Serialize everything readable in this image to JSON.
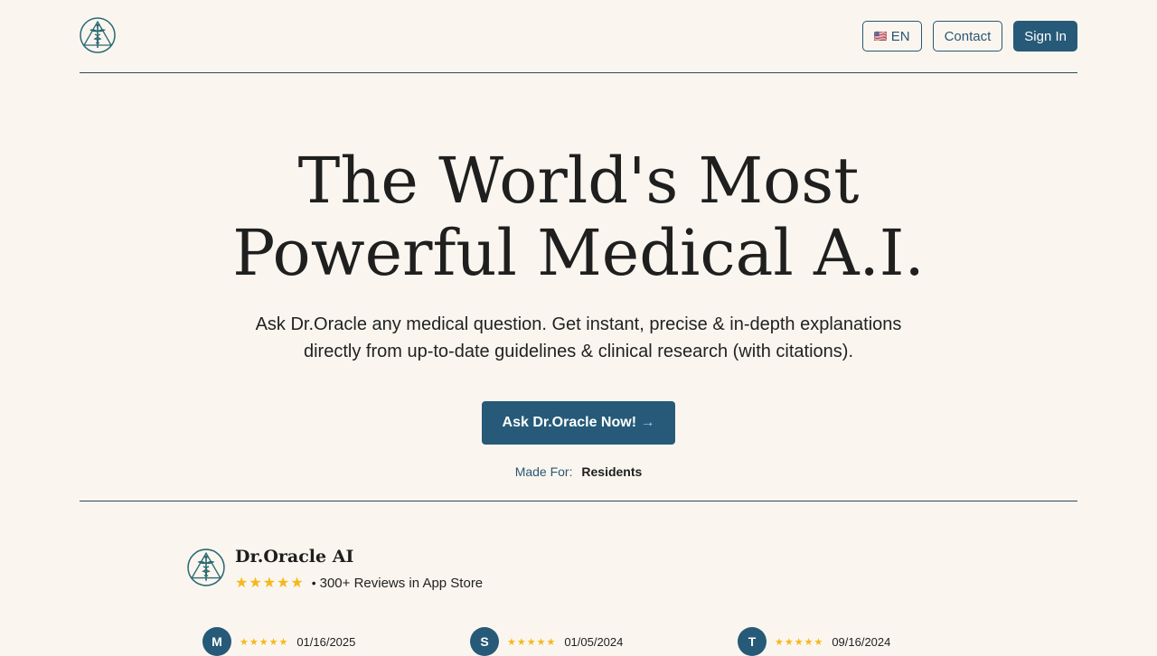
{
  "header": {
    "logo_icon": "caduceus-triangle-logo-icon",
    "language": {
      "flag": "🇺🇸",
      "label": "EN"
    },
    "contact_label": "Contact",
    "signin_label": "Sign In"
  },
  "hero": {
    "title_line1": "The World's Most",
    "title_line2": "Powerful Medical A.I.",
    "subtitle_line1": "Ask Dr.Oracle any medical question. Get instant, precise & in-depth explanations",
    "subtitle_line2": "directly from up-to-date guidelines & clinical research (with citations).",
    "cta_label": "Ask Dr.Oracle Now!",
    "cta_arrow": "→",
    "made_for_label": "Made For:",
    "made_for_value": "Residents"
  },
  "app": {
    "name": "Dr.Oracle AI",
    "stars": "★★★★★",
    "rating": 5,
    "separator": "•",
    "reviews_text": "300+ Reviews in App Store"
  },
  "reviews": [
    {
      "initial": "M",
      "stars": "★★★★★",
      "date": "01/16/2025"
    },
    {
      "initial": "S",
      "stars": "★★★★★",
      "date": "01/05/2024"
    },
    {
      "initial": "T",
      "stars": "★★★★★",
      "date": "09/16/2024"
    }
  ],
  "colors": {
    "background": "#faf6ef",
    "primary": "#265a78",
    "star": "#f5b81c",
    "text": "#1e1e1e"
  }
}
